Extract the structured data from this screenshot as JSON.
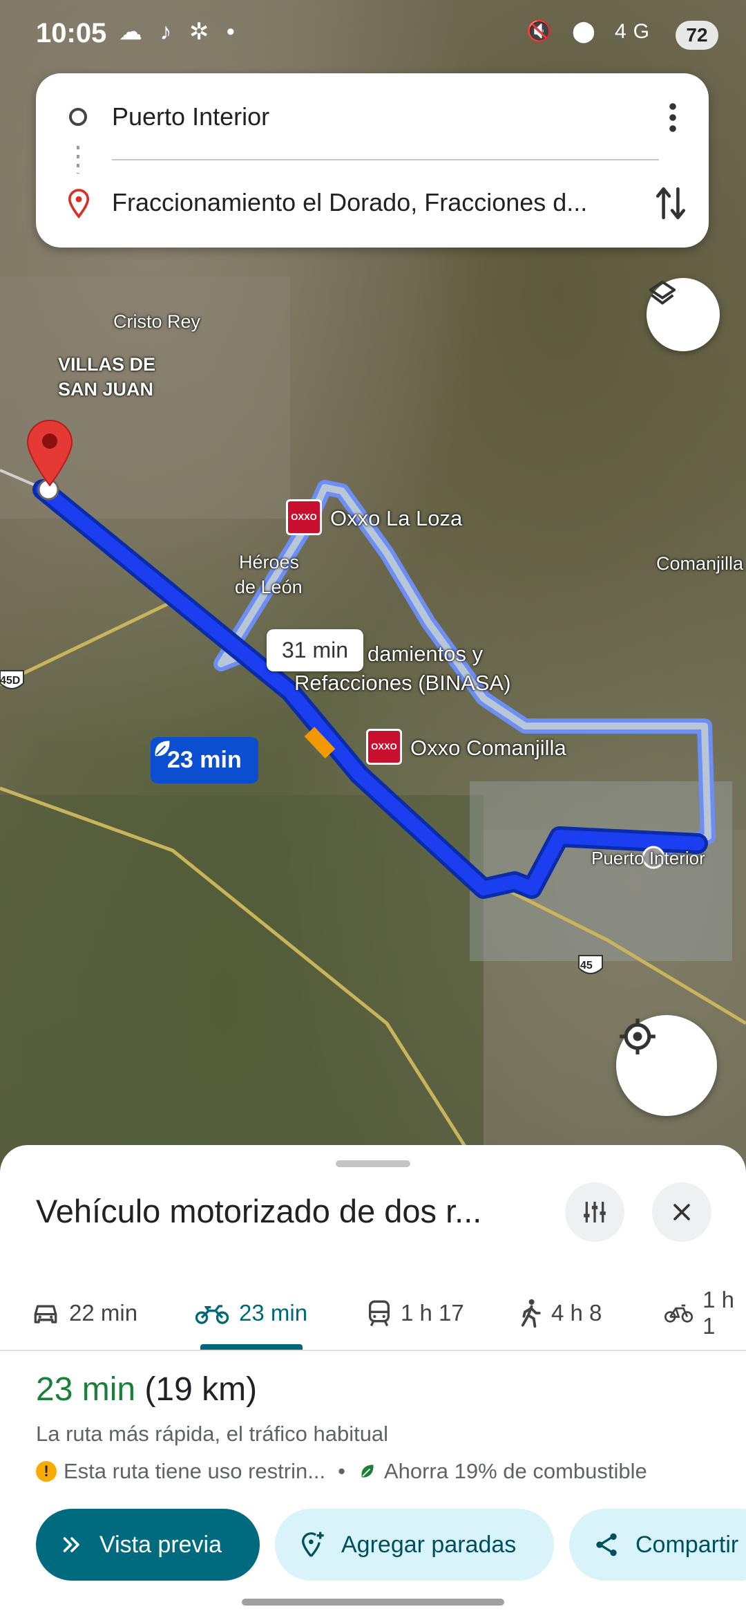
{
  "status_bar": {
    "time": "10:05",
    "left_icons": "☁ ♪ ✲ •",
    "right_icons": "🔇 ⬤ 4G",
    "battery": "72"
  },
  "route": {
    "origin": "Puerto Interior",
    "destination": "Fraccionamiento el Dorado, Fracciones d..."
  },
  "map": {
    "labels": {
      "cristo_rey": "Cristo Rey",
      "villas_line1": "VILLAS DE",
      "villas_line2": "SAN JUAN",
      "heroes_line1": "Héroes",
      "heroes_line2": "de León",
      "comanjilla": "Comanjilla",
      "puerto_interior": "Puerto Interior",
      "binasa_line1": "damientos y",
      "binasa_line2": "Refacciones (BINASA)",
      "oxxo_laloza": "Oxxo La Loza",
      "oxxo_comanjilla": "Oxxo Comanjilla",
      "highway_45": "45",
      "highway_45d": "45D"
    },
    "eta_alt": "31 min",
    "eta_main": "23 min"
  },
  "sheet": {
    "title": "Vehículo motorizado de dos r...",
    "modes": [
      {
        "icon": "car-icon",
        "label": "22 min"
      },
      {
        "icon": "motorcycle-icon",
        "label": "23 min"
      },
      {
        "icon": "transit-icon",
        "label": "1 h 17"
      },
      {
        "icon": "walk-icon",
        "label": "4 h 8"
      },
      {
        "icon": "bike-icon",
        "label": "1 h 1"
      }
    ],
    "summary_time": "23 min",
    "summary_distance": "(19 km)",
    "description": "La ruta más rápida, el tráfico habitual",
    "warning": "Esta ruta tiene uso restrin...",
    "separator": "•",
    "fuel": "Ahorra 19% de combustible",
    "buttons": {
      "preview": "Vista previa",
      "add_stops": "Agregar paradas",
      "share": "Compartir"
    }
  },
  "colors": {
    "route_main": "#1a3ef0",
    "route_alt": "#a8c0ff",
    "accent": "#006b7f",
    "green": "#188038"
  }
}
